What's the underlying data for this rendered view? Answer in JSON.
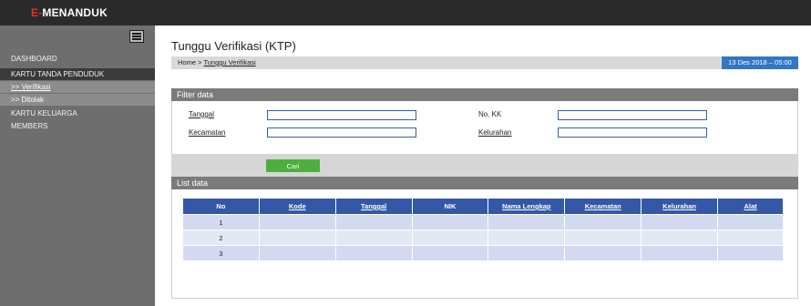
{
  "app": {
    "logo_accent": "E-",
    "logo_text": "MENANDUK"
  },
  "sidebar": {
    "items": [
      {
        "label": "DASHBOARD"
      },
      {
        "label": "KARTU TANDA PENDUDUK"
      },
      {
        "label": ">> Verifikasi"
      },
      {
        "label": ">> Ditolak"
      },
      {
        "label": "KARTU KELUARGA"
      },
      {
        "label": "MEMBERS"
      }
    ]
  },
  "header": {
    "title": "Tunggu Verifikasi (KTP)",
    "breadcrumb_home": "Home",
    "breadcrumb_sep": " > ",
    "breadcrumb_current": "Tunggu Verifikasi",
    "datetime": "13 Des 2018 – 05:00"
  },
  "filter": {
    "title": "Filter data",
    "tanggal_label": "Tanggal",
    "tanggal_value": "",
    "nokk_label": "No. KK",
    "nokk_value": "",
    "kecamatan_label": "Kecamatan",
    "kecamatan_value": "",
    "kelurahan_label": "Kelurahan",
    "kelurahan_value": "",
    "button": "Cari"
  },
  "list": {
    "title": "List data",
    "columns": [
      "No",
      "Kode",
      "Tanggal",
      "NIK",
      "Nama Lengkap",
      "Kecamatan",
      "Kelurahan",
      "Alat"
    ],
    "rows": [
      [
        "1",
        "",
        "",
        "",
        "",
        "",
        "",
        ""
      ],
      [
        "2",
        "",
        "",
        "",
        "",
        "",
        "",
        ""
      ],
      [
        "3",
        "",
        "",
        "",
        "",
        "",
        "",
        ""
      ]
    ]
  },
  "colors": {
    "topbar": "#2a2a2a",
    "sidebar": "#6e6e6e",
    "accent_red": "#e8331c",
    "table_header": "#3558a6",
    "date_badge": "#3277c4",
    "button_green": "#4caf3c"
  }
}
